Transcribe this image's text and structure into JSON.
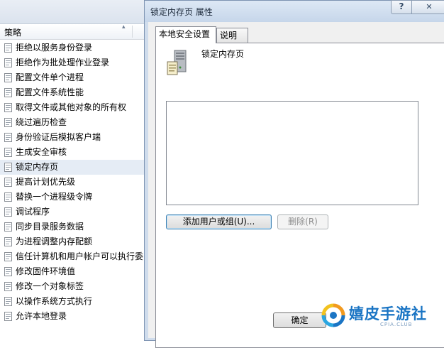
{
  "left_pane": {
    "column_header": "策略",
    "sort_arrow": "▴",
    "policies": [
      {
        "label": "拒绝以服务身份登录",
        "selected": false
      },
      {
        "label": "拒绝作为批处理作业登录",
        "selected": false
      },
      {
        "label": "配置文件单个进程",
        "selected": false
      },
      {
        "label": "配置文件系统性能",
        "selected": false
      },
      {
        "label": "取得文件或其他对象的所有权",
        "selected": false
      },
      {
        "label": "绕过遍历检查",
        "selected": false
      },
      {
        "label": "身份验证后模拟客户端",
        "selected": false
      },
      {
        "label": "生成安全审核",
        "selected": false
      },
      {
        "label": "锁定内存页",
        "selected": true
      },
      {
        "label": "提高计划优先级",
        "selected": false
      },
      {
        "label": "替换一个进程级令牌",
        "selected": false
      },
      {
        "label": "调试程序",
        "selected": false
      },
      {
        "label": "同步目录服务数据",
        "selected": false
      },
      {
        "label": "为进程调整内存配额",
        "selected": false
      },
      {
        "label": "信任计算机和用户帐户可以执行委",
        "selected": false
      },
      {
        "label": "修改固件环境值",
        "selected": false
      },
      {
        "label": "修改一个对象标签",
        "selected": false
      },
      {
        "label": "以操作系统方式执行",
        "selected": false
      },
      {
        "label": "允许本地登录",
        "selected": false
      }
    ]
  },
  "dialog": {
    "title": "锁定内存页 属性",
    "help_label": "?",
    "close_label": "✕",
    "tabs": [
      {
        "label": "本地安全设置",
        "active": true
      },
      {
        "label": "说明",
        "active": false
      }
    ],
    "policy_name": "锁定内存页",
    "icon": "server-icon",
    "users_list": [],
    "add_button": "添加用户或组(U)...",
    "remove_button": "删除(R)",
    "ok_button": "确定"
  },
  "watermark": {
    "text": "嬉皮手游社",
    "sub": "CPIA.CLUB",
    "color": "#1b75c4"
  },
  "colors": {
    "selected_row": "#e5ecf5",
    "dialog_frame": "#cfdcec",
    "accent_button_border": "#3c7fb1"
  }
}
